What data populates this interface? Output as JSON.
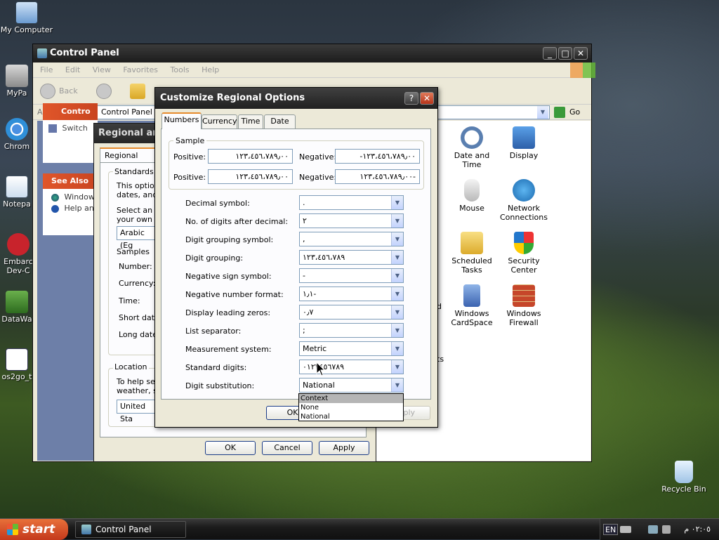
{
  "desktop": {
    "icons": [
      "My Computer",
      "MyPa",
      "Chrom",
      "Notepa",
      "Embarc Dev-C",
      "DataWa",
      "os2go_t",
      "Recycle Bin"
    ]
  },
  "control_panel": {
    "title": "Control Panel",
    "menu": [
      "File",
      "Edit",
      "View",
      "Favorites",
      "Tools",
      "Help"
    ],
    "back_label": "Back",
    "address_label": "Address",
    "address_value": "Control Panel",
    "go_label": "Go",
    "sidebar": {
      "panel_title": "Contro",
      "switch_text": "Switch",
      "see_also_title": "See Also",
      "links": [
        "Window",
        "Help an"
      ]
    },
    "items": [
      {
        "label": "Date and Time",
        "icon": "clock-icon"
      },
      {
        "label": "Display",
        "icon": "display-icon"
      },
      {
        "label": "Mouse",
        "icon": "mouse-icon"
      },
      {
        "label": "Network Connections",
        "icon": "network-icon"
      },
      {
        "label": "Scheduled Tasks",
        "icon": "folder-clock-icon"
      },
      {
        "label": "Security Center",
        "icon": "shield-icon"
      },
      {
        "label": "Windows CardSpace",
        "icon": "cardspace-icon"
      },
      {
        "label": "Windows Firewall",
        "icon": "firewall-icon"
      }
    ],
    "partial_labels": [
      "d",
      "ts"
    ]
  },
  "regional_dialog": {
    "title": "Regional and",
    "tab": "Regional Option",
    "standards_label": "Standards a",
    "standards_text_1": "This option",
    "standards_text_2": "dates, and t",
    "select_text_1": "Select an it",
    "select_text_2": "your own fo",
    "locale_value": "Arabic (Eg",
    "samples_label": "Samples",
    "sample_labels": [
      "Number:",
      "Currency:",
      "Time:",
      "Short date:",
      "Long date:"
    ],
    "location_label": "Location",
    "location_text_1": "To help ser",
    "location_text_2": "weather, se",
    "location_value": "United Sta",
    "ok": "OK",
    "cancel": "Cancel",
    "apply": "Apply"
  },
  "customize_dialog": {
    "title": "Customize Regional Options",
    "help_glyph": "?",
    "tabs": [
      "Numbers",
      "Currency",
      "Time",
      "Date"
    ],
    "sample_group": "Sample",
    "positive_label": "Positive:",
    "negative_label": "Negative:",
    "sample_positive_1": "١٢٣،٤٥٦،٧٨٩٫٠٠",
    "sample_negative_1": "١٢٣،٤٥٦،٧٨٩٫٠٠-",
    "sample_positive_2": "١٢٣،٤٥٦،٧٨٩٫٠٠",
    "sample_negative_2": "-١٢٣،٤٥٦،٧٨٩٫٠٠",
    "settings": [
      {
        "label": "Decimal symbol:",
        "value": "."
      },
      {
        "label": "No. of digits after decimal:",
        "value": "٢"
      },
      {
        "label": "Digit grouping symbol:",
        "value": ","
      },
      {
        "label": "Digit grouping:",
        "value": "١٢٣،٤٥٦،٧٨٩"
      },
      {
        "label": "Negative sign symbol:",
        "value": "-"
      },
      {
        "label": "Negative number format:",
        "value": "١٫١-"
      },
      {
        "label": "Display leading zeros:",
        "value": "٠٫٧"
      },
      {
        "label": "List separator:",
        "value": ";"
      },
      {
        "label": "Measurement system:",
        "value": "Metric"
      },
      {
        "label": "Standard digits:",
        "value": "٠١٢٣٤٥٦٧٨٩"
      },
      {
        "label": "Digit substitution:",
        "value": "National"
      }
    ],
    "dropdown_options": [
      "Context",
      "None",
      "National"
    ],
    "dropdown_highlight": "Context",
    "ok": "OK",
    "apply": "Apply"
  },
  "taskbar": {
    "start": "start",
    "task": "Control Panel",
    "lang": "EN",
    "clock": "٠٢:٠٥ م"
  }
}
